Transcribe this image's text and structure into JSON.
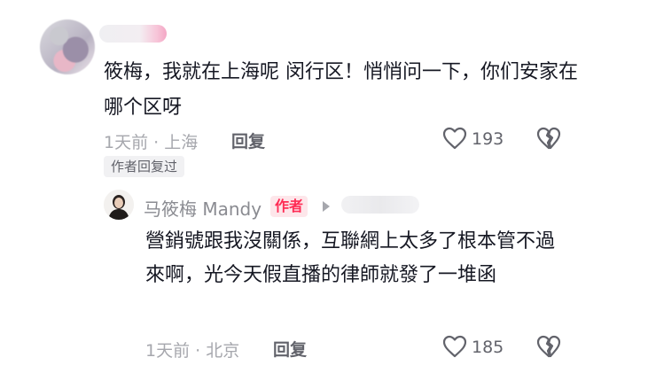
{
  "comment": {
    "text": "筱梅，我就在上海呢 闵行区！悄悄问一下，你们安家在哪个区呀",
    "time_location": "1天前 · 上海",
    "reply_label": "回复",
    "like_count": "193",
    "author_replied_tag": "作者回复过"
  },
  "reply": {
    "username": "马筱梅 Mandy",
    "author_badge": "作者",
    "text": "營銷號跟我沒關係，互聯網上太多了根本管不過來啊，光今天假直播的律師就發了一堆函",
    "time_location": "1天前 · 北京",
    "reply_label": "回复",
    "like_count": "185"
  },
  "icons": {
    "like": "heart-outline-icon",
    "dislike": "broken-heart-icon",
    "arrow": "triangle-right-icon"
  },
  "colors": {
    "accent": "#fe2c55",
    "meta": "#a6a7ad",
    "text": "#161823"
  }
}
